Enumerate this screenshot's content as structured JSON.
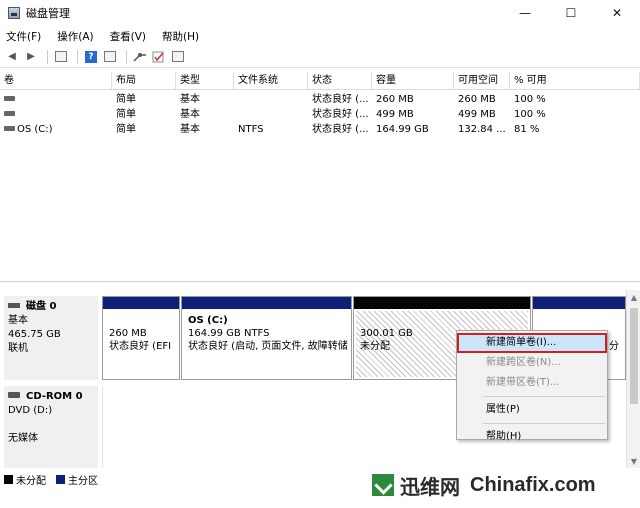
{
  "window": {
    "title": "磁盘管理",
    "controls": {
      "minimize": "—",
      "maximize": "☐",
      "close": "✕"
    }
  },
  "menu": [
    "文件(F)",
    "操作(A)",
    "查看(V)",
    "帮助(H)"
  ],
  "toolbar": {
    "back": "◀",
    "forward": "▶",
    "help": "?"
  },
  "volumes": {
    "columns": [
      "卷",
      "布局",
      "类型",
      "文件系统",
      "状态",
      "容量",
      "可用空间",
      "% 可用"
    ],
    "rows": [
      {
        "volume": "",
        "layout": "简单",
        "type": "基本",
        "fs": "",
        "status": "状态良好 (...",
        "capacity": "260 MB",
        "free": "260 MB",
        "pct": "100 %"
      },
      {
        "volume": "",
        "layout": "简单",
        "type": "基本",
        "fs": "",
        "status": "状态良好 (...",
        "capacity": "499 MB",
        "free": "499 MB",
        "pct": "100 %"
      },
      {
        "volume": "OS (C:)",
        "layout": "简单",
        "type": "基本",
        "fs": "NTFS",
        "status": "状态良好 (...",
        "capacity": "164.99 GB",
        "free": "132.84 ...",
        "pct": "81 %"
      }
    ]
  },
  "disks": {
    "disk0": {
      "name": "磁盘 0",
      "type": "基本",
      "size": "465.75 GB",
      "state": "联机",
      "partitions": [
        {
          "name": "",
          "size": "260 MB",
          "status": "状态良好 (EFI",
          "color": "#0e1f78"
        },
        {
          "name": "OS (C:)",
          "size": "164.99 GB NTFS",
          "status": "状态良好 (启动, 页面文件, 故障转储",
          "color": "#0e1f78"
        },
        {
          "name": "",
          "size": "300.01 GB",
          "status": "未分配",
          "color": "#050505"
        },
        {
          "name": "",
          "size": "",
          "status": "分",
          "color": "#0e1f78"
        }
      ]
    },
    "cdrom0": {
      "name": "CD-ROM 0",
      "drive": "DVD (D:)",
      "media": "无媒体"
    }
  },
  "legend": [
    {
      "label": "未分配",
      "color": "#050505"
    },
    {
      "label": "主分区",
      "color": "#0e1f78"
    }
  ],
  "context_menu": {
    "items": [
      {
        "label": "新建简单卷(I)...",
        "state": "highlighted"
      },
      {
        "label": "新建跨区卷(N)...",
        "state": "disabled"
      },
      {
        "label": "新建带区卷(T)...",
        "state": "disabled"
      },
      {
        "label": "属性(P)",
        "state": "enabled"
      },
      {
        "label": "帮助(H)",
        "state": "enabled"
      }
    ]
  },
  "watermark": {
    "cn": "迅维网",
    "en": "Chinafix.com"
  }
}
